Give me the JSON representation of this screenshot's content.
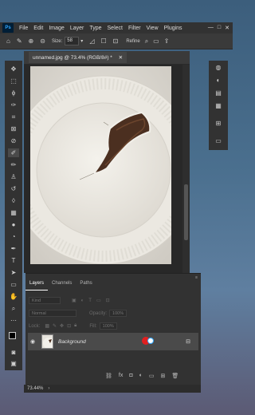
{
  "menubar": {
    "logo": "Ps",
    "items": [
      "File",
      "Edit",
      "Image",
      "Layer",
      "Type",
      "Select",
      "Filter",
      "View",
      "Plugins"
    ],
    "controls": [
      "—",
      "□",
      "✕"
    ]
  },
  "optionsbar": {
    "size_label": "Size:",
    "size_value": "58",
    "refine_label": "Refine"
  },
  "document": {
    "tab_title": "unnamed.jpg @ 73.4% (RGB/8#) *",
    "close": "✕"
  },
  "layers_panel": {
    "tabs": [
      "Layers",
      "Channels",
      "Paths"
    ],
    "kind_placeholder": "Kind",
    "blend_mode": "Normal",
    "opacity_label": "Opacity:",
    "opacity_value": "100%",
    "lock_label": "Lock:",
    "fill_label": "Fill:",
    "fill_value": "100%",
    "layers": [
      {
        "name": "Background",
        "visible": true,
        "locked": true
      }
    ],
    "bottom_icons": [
      "link-icon",
      "fx-icon",
      "mask-icon",
      "adjustment-icon",
      "group-icon",
      "new-layer-icon",
      "delete-icon"
    ]
  },
  "status": {
    "zoom": "73.44%",
    "arrow": "›"
  },
  "tools": [
    "move",
    "marquee",
    "lasso",
    "quick-select",
    "crop",
    "frame",
    "eyedropper",
    "spot-heal",
    "brush",
    "clone",
    "history-brush",
    "eraser",
    "gradient",
    "blur",
    "dodge",
    "pen",
    "type",
    "path-select",
    "rectangle",
    "hand",
    "zoom",
    "more"
  ],
  "colors": {
    "accent_red": "#e02020",
    "accent_blue": "#31a8ff"
  }
}
